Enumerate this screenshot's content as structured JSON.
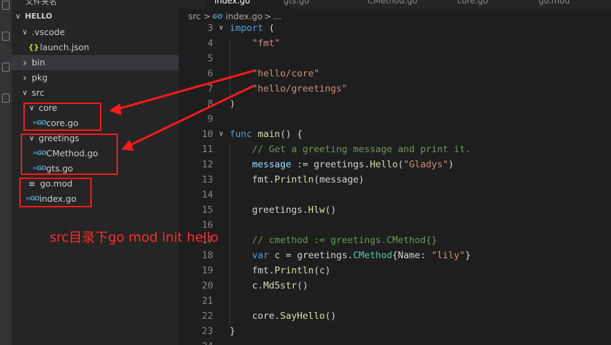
{
  "sidebar": {
    "header": "文件夹名",
    "items": [
      {
        "label": "HELLO",
        "kind": "root",
        "expanded": true
      },
      {
        "label": ".vscode",
        "kind": "folder",
        "expanded": true
      },
      {
        "label": "launch.json",
        "kind": "json"
      },
      {
        "label": "bin",
        "kind": "folder",
        "expanded": false,
        "selected": true
      },
      {
        "label": "pkg",
        "kind": "folder",
        "expanded": false
      },
      {
        "label": "src",
        "kind": "folder",
        "expanded": true
      },
      {
        "label": "core",
        "kind": "folder",
        "expanded": true
      },
      {
        "label": "core.go",
        "kind": "go"
      },
      {
        "label": "greetings",
        "kind": "folder",
        "expanded": true
      },
      {
        "label": "CMethod.go",
        "kind": "go"
      },
      {
        "label": "gts.go",
        "kind": "go"
      },
      {
        "label": "go.mod",
        "kind": "mod"
      },
      {
        "label": "index.go",
        "kind": "go"
      }
    ]
  },
  "tabs": [
    {
      "label": "index.go",
      "active": true
    },
    {
      "label": "gts.go"
    },
    {
      "label": "CMethod.go"
    },
    {
      "label": "core.go"
    },
    {
      "label": "go.mod"
    }
  ],
  "breadcrumb": {
    "folder": "src",
    "sep": ">",
    "file": "index.go",
    "tail": "..."
  },
  "editor": {
    "lines": [
      {
        "n": "3",
        "fold": "v",
        "tokens": [
          [
            "kw",
            "import"
          ],
          [
            "pl",
            " ("
          ]
        ]
      },
      {
        "n": "4",
        "tokens": [
          [
            "pl",
            "    "
          ],
          [
            "str",
            "\"fmt\""
          ]
        ]
      },
      {
        "n": "5",
        "tokens": []
      },
      {
        "n": "6",
        "tokens": [
          [
            "pl",
            "    "
          ],
          [
            "str",
            "\"hello/core\""
          ]
        ]
      },
      {
        "n": "7",
        "tokens": [
          [
            "pl",
            "    "
          ],
          [
            "str",
            "\"hello/greetings\""
          ]
        ]
      },
      {
        "n": "8",
        "tokens": [
          [
            "pl",
            ")"
          ]
        ]
      },
      {
        "n": "9",
        "tokens": []
      },
      {
        "n": "10",
        "fold": "v",
        "tokens": [
          [
            "kw",
            "func"
          ],
          [
            "pl",
            " "
          ],
          [
            "fn",
            "main"
          ],
          [
            "pl",
            "() {"
          ]
        ]
      },
      {
        "n": "11",
        "tokens": [
          [
            "pl",
            "    "
          ],
          [
            "cmt",
            "// Get a greeting message and print it."
          ]
        ]
      },
      {
        "n": "12",
        "tokens": [
          [
            "pl",
            "    "
          ],
          [
            "var",
            "message"
          ],
          [
            "pl",
            " := greetings."
          ],
          [
            "fn",
            "Hello"
          ],
          [
            "pl",
            "("
          ],
          [
            "str",
            "\"Gladys\""
          ],
          [
            "pl",
            ")"
          ]
        ]
      },
      {
        "n": "13",
        "tokens": [
          [
            "pl",
            "    fmt."
          ],
          [
            "fn",
            "Println"
          ],
          [
            "pl",
            "(message)"
          ]
        ]
      },
      {
        "n": "14",
        "tokens": []
      },
      {
        "n": "15",
        "tokens": [
          [
            "pl",
            "    greetings."
          ],
          [
            "fn",
            "Hlw"
          ],
          [
            "pl",
            "()"
          ]
        ]
      },
      {
        "n": "16",
        "tokens": []
      },
      {
        "n": "17",
        "tokens": [
          [
            "pl",
            "    "
          ],
          [
            "cmt",
            "// cmethod := greetings.CMethod{}"
          ]
        ]
      },
      {
        "n": "18",
        "tokens": [
          [
            "pl",
            "    "
          ],
          [
            "kw",
            "var"
          ],
          [
            "pl",
            " "
          ],
          [
            "var",
            "c"
          ],
          [
            "pl",
            " = greetings."
          ],
          [
            "typ",
            "CMethod"
          ],
          [
            "pl",
            "{Name: "
          ],
          [
            "str",
            "\"lily\""
          ],
          [
            "pl",
            "}"
          ]
        ]
      },
      {
        "n": "19",
        "tokens": [
          [
            "pl",
            "    fmt."
          ],
          [
            "fn",
            "Println"
          ],
          [
            "pl",
            "(c)"
          ]
        ]
      },
      {
        "n": "20",
        "tokens": [
          [
            "pl",
            "    c."
          ],
          [
            "fn",
            "Md5str"
          ],
          [
            "pl",
            "()"
          ]
        ]
      },
      {
        "n": "21",
        "tokens": []
      },
      {
        "n": "22",
        "tokens": [
          [
            "pl",
            "    core."
          ],
          [
            "fn",
            "SayHello"
          ],
          [
            "pl",
            "()"
          ]
        ]
      },
      {
        "n": "23",
        "tokens": [
          [
            "pl",
            "}"
          ]
        ]
      },
      {
        "n": "24",
        "tokens": []
      }
    ]
  },
  "annotation": {
    "text": "src目录下go mod init hello",
    "color": "#ff2a2a"
  },
  "colors": {
    "keyword": "#569cd6",
    "string": "#ce9178",
    "function": "#dcdcaa",
    "variable": "#9cdcfe",
    "comment": "#6a9955",
    "type": "#4ec9b0",
    "annotation_red": "#ff1a1a"
  }
}
